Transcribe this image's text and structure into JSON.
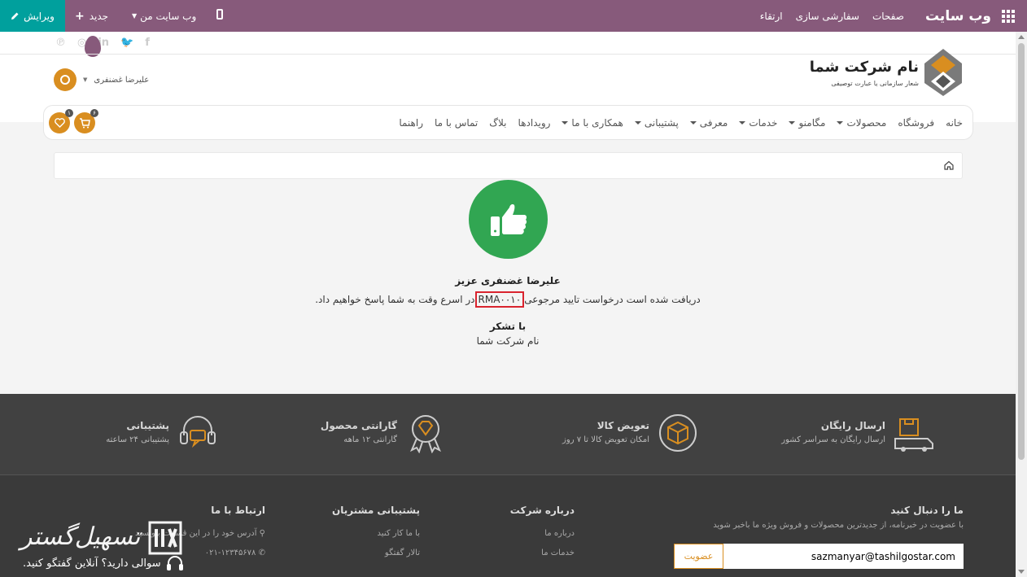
{
  "topbar": {
    "brand": "وب سایت",
    "nav": [
      "صفحات",
      "سفارشی سازی",
      "ارتقاء"
    ],
    "mysite_label": "وب سایت من",
    "new_label": "جدید",
    "edit_label": "ویرایش",
    "color": "#875a7b",
    "edit_color": "#00a09d"
  },
  "header": {
    "company_name": "نام شرکت شما",
    "tagline": "شعار سازمانی یا عبارت توصیفی",
    "user_name": "علیرضا غضنفری",
    "accent": "#d98e20"
  },
  "menu": [
    {
      "label": "خانه",
      "dropdown": false
    },
    {
      "label": "فروشگاه",
      "dropdown": false
    },
    {
      "label": "محصولات",
      "dropdown": true
    },
    {
      "label": "مگامنو",
      "dropdown": true
    },
    {
      "label": "خدمات",
      "dropdown": true
    },
    {
      "label": "معرفی",
      "dropdown": true
    },
    {
      "label": "پشتیبانی",
      "dropdown": true
    },
    {
      "label": "همکاری با ما",
      "dropdown": true
    },
    {
      "label": "رویدادها",
      "dropdown": false
    },
    {
      "label": "بلاگ",
      "dropdown": false
    },
    {
      "label": "تماس با ما",
      "dropdown": false
    },
    {
      "label": "راهنما",
      "dropdown": false
    }
  ],
  "cart_count": "۶",
  "wishlist_count": "۱",
  "confirmation": {
    "greeting": "علیرضا غضنفری عزیز",
    "line_before": "دریافت شده است درخواست تایید مرجوعی",
    "reference": "RMA۰۰۱۰",
    "line_after": "در اسرع وقت به شما پاسخ خواهیم داد.",
    "thanks": "با تشکر",
    "signature": "نام شرکت شما",
    "icon": "thumbs-up-icon"
  },
  "features": [
    {
      "title": "ارسال رایگان",
      "subtitle": "ارسال رایگان به سراسر کشور",
      "icon": "delivery-truck-icon"
    },
    {
      "title": "تعویض کالا",
      "subtitle": "امکان تعویض کالا تا ۷ روز",
      "icon": "package-return-icon"
    },
    {
      "title": "گارانتی محصول",
      "subtitle": "گارانتی ۱۲ ماهه",
      "icon": "diamond-badge-icon"
    },
    {
      "title": "پشتیبانی",
      "subtitle": "پشتیبانی ۲۴ ساعته",
      "icon": "headset-icon"
    }
  ],
  "footer": {
    "newsletter_title": "ما را دنبال کنید",
    "newsletter_text": "با عضویت در خبرنامه، از جدیدترین محصولات و فروش ویژه ما باخبر شوید",
    "email_value": "sazmanyar@tashilgostar.com",
    "subscribe_label": "عضویت",
    "about_title": "درباره شرکت",
    "about_items": [
      "درباره ما",
      "خدمات ما"
    ],
    "support_title": "پشتیبانی مشتریان",
    "support_items": [
      "با ما کار کنید",
      "تالار گفتگو"
    ],
    "contact_title": "ارتباط با ما",
    "contact_items": [
      "آدرس خود را در این قسمت بنویسید",
      "۰۲۱-۱۲۳۴۵۶۷۸"
    ]
  },
  "chat_text": "سوالی دارید؟ آنلاین گفتگو کنید.",
  "watermark": "تسهیل‌گستر"
}
